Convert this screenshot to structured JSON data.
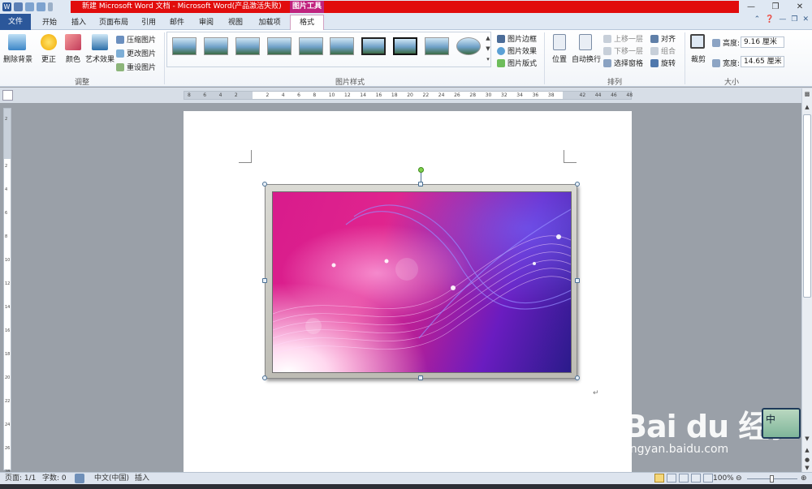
{
  "titlebar": {
    "title": "新建 Microsoft Word 文档 - Microsoft Word(产品激活失败)",
    "context_tool": "图片工具"
  },
  "tabs": [
    {
      "label": "文件"
    },
    {
      "label": "开始"
    },
    {
      "label": "插入"
    },
    {
      "label": "页面布局"
    },
    {
      "label": "引用"
    },
    {
      "label": "邮件"
    },
    {
      "label": "审阅"
    },
    {
      "label": "视图"
    },
    {
      "label": "加载项"
    },
    {
      "label": "格式"
    }
  ],
  "ribbon": {
    "adjust": {
      "remove_bg": "删除背景",
      "corrections": "更正",
      "color": "颜色",
      "artistic": "艺术效果",
      "compress": "压缩图片",
      "change": "更改图片",
      "reset": "重设图片",
      "group_label": "调整"
    },
    "styles": {
      "group_label": "图片样式",
      "border": "图片边框",
      "effects": "图片效果",
      "layout": "图片版式"
    },
    "arrange": {
      "position": "位置",
      "wrap": "自动换行",
      "bring_forward": "上移一层",
      "send_backward": "下移一层",
      "selection_pane": "选择窗格",
      "align": "对齐",
      "group": "组合",
      "rotate": "旋转",
      "group_label": "排列"
    },
    "size": {
      "crop": "裁剪",
      "height_label": "高度:",
      "height_value": "9.16 厘米",
      "width_label": "宽度:",
      "width_value": "14.65 厘米",
      "group_label": "大小"
    }
  },
  "ruler": {
    "h_ticks": [
      "8",
      "6",
      "4",
      "2",
      "",
      "2",
      "4",
      "6",
      "8",
      "10",
      "12",
      "14",
      "16",
      "18",
      "20",
      "22",
      "24",
      "26",
      "28",
      "30",
      "32",
      "34",
      "36",
      "38",
      "",
      "42",
      "44",
      "46",
      "48"
    ],
    "v_ticks": [
      "2",
      "",
      "2",
      "4",
      "6",
      "8",
      "10",
      "12",
      "14",
      "16",
      "18",
      "20",
      "22",
      "24",
      "26",
      "28"
    ]
  },
  "statusbar": {
    "page": "页面: 1/1",
    "words": "字数: 0",
    "language": "中文(中国)",
    "mode": "插入",
    "zoom": "100%"
  },
  "watermark": {
    "brand": "Bai du 经验",
    "url": "jingyan.baidu.com"
  },
  "ime": {
    "label": "中"
  }
}
